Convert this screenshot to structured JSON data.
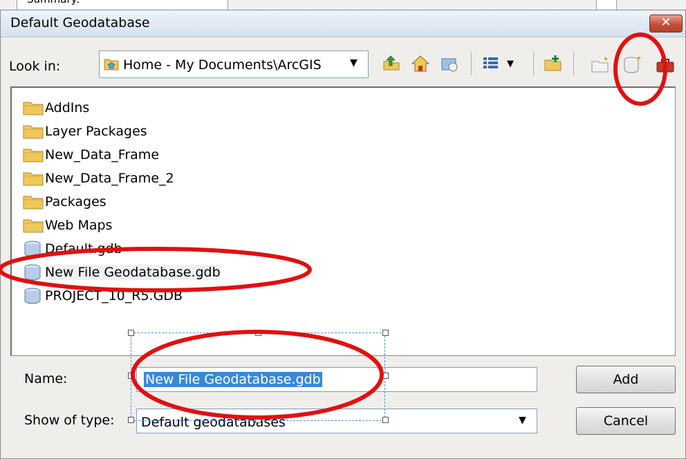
{
  "behind": {
    "text": "Summary:"
  },
  "dialog": {
    "title": "Default Geodatabase",
    "close_label": "✕"
  },
  "lookin": {
    "label": "Look in:",
    "value": "Home - My Documents\\ArcGIS"
  },
  "toolbar": {
    "icons": [
      "up-one-level-icon",
      "home-icon",
      "catalog-connections-icon",
      "view-menu-icon",
      "connect-folder-icon",
      "new-folder-icon",
      "new-file-geodatabase-icon",
      "new-toolbox-icon"
    ]
  },
  "files": [
    {
      "name": "AddIns",
      "type": "folder"
    },
    {
      "name": "Layer Packages",
      "type": "folder"
    },
    {
      "name": "New_Data_Frame",
      "type": "folder"
    },
    {
      "name": "New_Data_Frame_2",
      "type": "folder"
    },
    {
      "name": "Packages",
      "type": "folder"
    },
    {
      "name": "Web Maps",
      "type": "folder"
    },
    {
      "name": "Default.gdb",
      "type": "geodatabase"
    },
    {
      "name": "New File Geodatabase.gdb",
      "type": "geodatabase"
    },
    {
      "name": "PROJECT_10_R5.GDB",
      "type": "geodatabase"
    }
  ],
  "name_field": {
    "label": "Name:",
    "value": "New File Geodatabase.gdb"
  },
  "type_field": {
    "label": "Show of type:",
    "value": "Default geodatabases"
  },
  "buttons": {
    "add": "Add",
    "cancel": "Cancel"
  },
  "colors": {
    "annotation": "#e01010",
    "selection": "#3a88d6",
    "folder": "#f0c85a"
  }
}
